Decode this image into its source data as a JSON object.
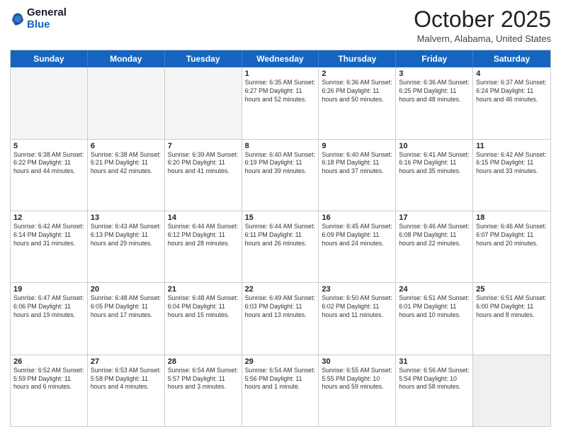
{
  "logo": {
    "general": "General",
    "blue": "Blue"
  },
  "header": {
    "month": "October 2025",
    "location": "Malvern, Alabama, United States"
  },
  "weekdays": [
    "Sunday",
    "Monday",
    "Tuesday",
    "Wednesday",
    "Thursday",
    "Friday",
    "Saturday"
  ],
  "rows": [
    [
      {
        "day": "",
        "info": "",
        "empty": true
      },
      {
        "day": "",
        "info": "",
        "empty": true
      },
      {
        "day": "",
        "info": "",
        "empty": true
      },
      {
        "day": "1",
        "info": "Sunrise: 6:35 AM\nSunset: 6:27 PM\nDaylight: 11 hours\nand 52 minutes.",
        "empty": false
      },
      {
        "day": "2",
        "info": "Sunrise: 6:36 AM\nSunset: 6:26 PM\nDaylight: 11 hours\nand 50 minutes.",
        "empty": false
      },
      {
        "day": "3",
        "info": "Sunrise: 6:36 AM\nSunset: 6:25 PM\nDaylight: 11 hours\nand 48 minutes.",
        "empty": false
      },
      {
        "day": "4",
        "info": "Sunrise: 6:37 AM\nSunset: 6:24 PM\nDaylight: 11 hours\nand 46 minutes.",
        "empty": false
      }
    ],
    [
      {
        "day": "5",
        "info": "Sunrise: 6:38 AM\nSunset: 6:22 PM\nDaylight: 11 hours\nand 44 minutes.",
        "empty": false
      },
      {
        "day": "6",
        "info": "Sunrise: 6:38 AM\nSunset: 6:21 PM\nDaylight: 11 hours\nand 42 minutes.",
        "empty": false
      },
      {
        "day": "7",
        "info": "Sunrise: 6:39 AM\nSunset: 6:20 PM\nDaylight: 11 hours\nand 41 minutes.",
        "empty": false
      },
      {
        "day": "8",
        "info": "Sunrise: 6:40 AM\nSunset: 6:19 PM\nDaylight: 11 hours\nand 39 minutes.",
        "empty": false
      },
      {
        "day": "9",
        "info": "Sunrise: 6:40 AM\nSunset: 6:18 PM\nDaylight: 11 hours\nand 37 minutes.",
        "empty": false
      },
      {
        "day": "10",
        "info": "Sunrise: 6:41 AM\nSunset: 6:16 PM\nDaylight: 11 hours\nand 35 minutes.",
        "empty": false
      },
      {
        "day": "11",
        "info": "Sunrise: 6:42 AM\nSunset: 6:15 PM\nDaylight: 11 hours\nand 33 minutes.",
        "empty": false
      }
    ],
    [
      {
        "day": "12",
        "info": "Sunrise: 6:42 AM\nSunset: 6:14 PM\nDaylight: 11 hours\nand 31 minutes.",
        "empty": false
      },
      {
        "day": "13",
        "info": "Sunrise: 6:43 AM\nSunset: 6:13 PM\nDaylight: 11 hours\nand 29 minutes.",
        "empty": false
      },
      {
        "day": "14",
        "info": "Sunrise: 6:44 AM\nSunset: 6:12 PM\nDaylight: 11 hours\nand 28 minutes.",
        "empty": false
      },
      {
        "day": "15",
        "info": "Sunrise: 6:44 AM\nSunset: 6:11 PM\nDaylight: 11 hours\nand 26 minutes.",
        "empty": false
      },
      {
        "day": "16",
        "info": "Sunrise: 6:45 AM\nSunset: 6:09 PM\nDaylight: 11 hours\nand 24 minutes.",
        "empty": false
      },
      {
        "day": "17",
        "info": "Sunrise: 6:46 AM\nSunset: 6:08 PM\nDaylight: 11 hours\nand 22 minutes.",
        "empty": false
      },
      {
        "day": "18",
        "info": "Sunrise: 6:46 AM\nSunset: 6:07 PM\nDaylight: 11 hours\nand 20 minutes.",
        "empty": false
      }
    ],
    [
      {
        "day": "19",
        "info": "Sunrise: 6:47 AM\nSunset: 6:06 PM\nDaylight: 11 hours\nand 19 minutes.",
        "empty": false
      },
      {
        "day": "20",
        "info": "Sunrise: 6:48 AM\nSunset: 6:05 PM\nDaylight: 11 hours\nand 17 minutes.",
        "empty": false
      },
      {
        "day": "21",
        "info": "Sunrise: 6:48 AM\nSunset: 6:04 PM\nDaylight: 11 hours\nand 15 minutes.",
        "empty": false
      },
      {
        "day": "22",
        "info": "Sunrise: 6:49 AM\nSunset: 6:03 PM\nDaylight: 11 hours\nand 13 minutes.",
        "empty": false
      },
      {
        "day": "23",
        "info": "Sunrise: 6:50 AM\nSunset: 6:02 PM\nDaylight: 11 hours\nand 11 minutes.",
        "empty": false
      },
      {
        "day": "24",
        "info": "Sunrise: 6:51 AM\nSunset: 6:01 PM\nDaylight: 11 hours\nand 10 minutes.",
        "empty": false
      },
      {
        "day": "25",
        "info": "Sunrise: 6:51 AM\nSunset: 6:00 PM\nDaylight: 11 hours\nand 8 minutes.",
        "empty": false
      }
    ],
    [
      {
        "day": "26",
        "info": "Sunrise: 6:52 AM\nSunset: 5:59 PM\nDaylight: 11 hours\nand 6 minutes.",
        "empty": false
      },
      {
        "day": "27",
        "info": "Sunrise: 6:53 AM\nSunset: 5:58 PM\nDaylight: 11 hours\nand 4 minutes.",
        "empty": false
      },
      {
        "day": "28",
        "info": "Sunrise: 6:54 AM\nSunset: 5:57 PM\nDaylight: 11 hours\nand 3 minutes.",
        "empty": false
      },
      {
        "day": "29",
        "info": "Sunrise: 6:54 AM\nSunset: 5:56 PM\nDaylight: 11 hours\nand 1 minute.",
        "empty": false
      },
      {
        "day": "30",
        "info": "Sunrise: 6:55 AM\nSunset: 5:55 PM\nDaylight: 10 hours\nand 59 minutes.",
        "empty": false
      },
      {
        "day": "31",
        "info": "Sunrise: 6:56 AM\nSunset: 5:54 PM\nDaylight: 10 hours\nand 58 minutes.",
        "empty": false
      },
      {
        "day": "",
        "info": "",
        "empty": true,
        "gray": true
      }
    ]
  ]
}
